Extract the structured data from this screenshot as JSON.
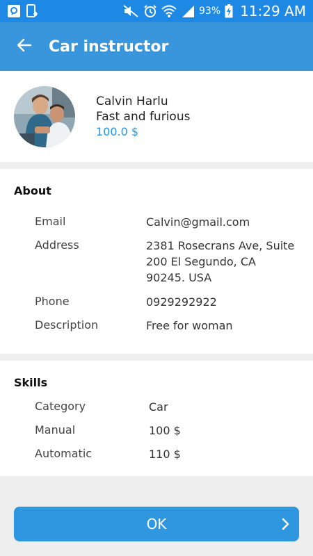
{
  "statusbar": {
    "battery_pct": "93%",
    "time": "11:29 AM"
  },
  "appbar": {
    "title": "Car instructor"
  },
  "profile": {
    "name": "Calvin Harlu",
    "tagline": "Fast and furious",
    "price": "100.0 $"
  },
  "about": {
    "title": "About",
    "rows": [
      {
        "label": "Email",
        "value": "Calvin@gmail.com"
      },
      {
        "label": "Address",
        "value_lines": [
          "2381 Rosecrans Ave, Suite",
          "200 El Segundo, CA",
          "90245. USA"
        ]
      },
      {
        "label": "Phone",
        "value": "0929292922"
      },
      {
        "label": "Description",
        "value": "Free for woman"
      }
    ]
  },
  "skills": {
    "title": "Skills",
    "rows": [
      {
        "label": "Category",
        "value": "Car"
      },
      {
        "label": "Manual",
        "value": "100 $"
      },
      {
        "label": "Automatic",
        "value": "110 $"
      }
    ]
  },
  "actions": {
    "ok_label": "OK"
  },
  "colors": {
    "statusbar": "#1e88e5",
    "appbar": "#3a96dc",
    "accent": "#2196f3",
    "ok_button": "#2f96e0"
  }
}
